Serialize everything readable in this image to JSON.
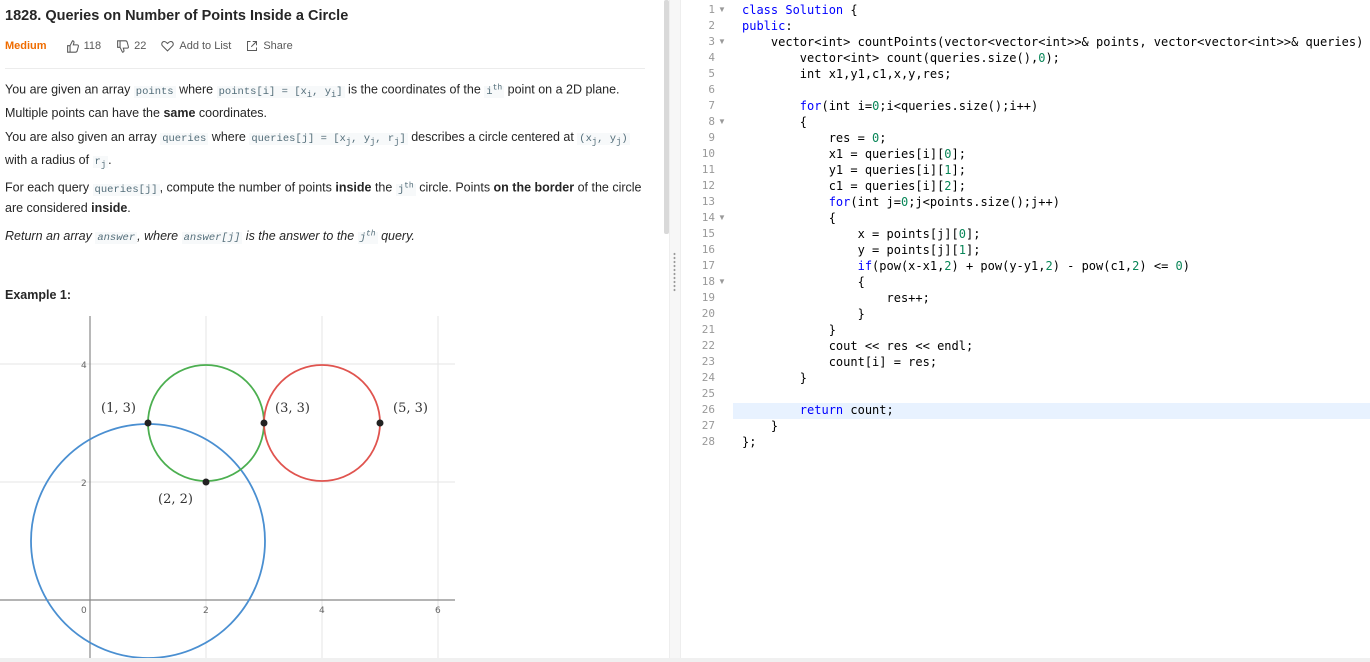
{
  "problem": {
    "title": "1828. Queries on Number of Points Inside a Circle",
    "difficulty": "Medium",
    "likes": "118",
    "dislikes": "22",
    "add_to_list": "Add to List",
    "share": "Share",
    "example_heading": "Example 1:"
  },
  "graph": {
    "labels": [
      "(1, 3)",
      "(3, 3)",
      "(5, 3)",
      "(2, 2)"
    ],
    "tick_labels": [
      "0",
      "2",
      "4",
      "6",
      "2",
      "4"
    ],
    "colors": {
      "blue": "#4a8fd1",
      "green": "#4caf50",
      "red": "#e0544f"
    }
  },
  "code": {
    "line_numbers": [
      "1",
      "2",
      "3",
      "4",
      "5",
      "6",
      "7",
      "8",
      "9",
      "10",
      "11",
      "12",
      "13",
      "14",
      "15",
      "16",
      "17",
      "18",
      "19",
      "20",
      "21",
      "22",
      "23",
      "24",
      "25",
      "26",
      "27",
      "28"
    ]
  },
  "colors": {
    "accent": "#ef6c00",
    "keyword": "#0000ff",
    "number": "#098658",
    "highlight": "#e8f2ff"
  }
}
